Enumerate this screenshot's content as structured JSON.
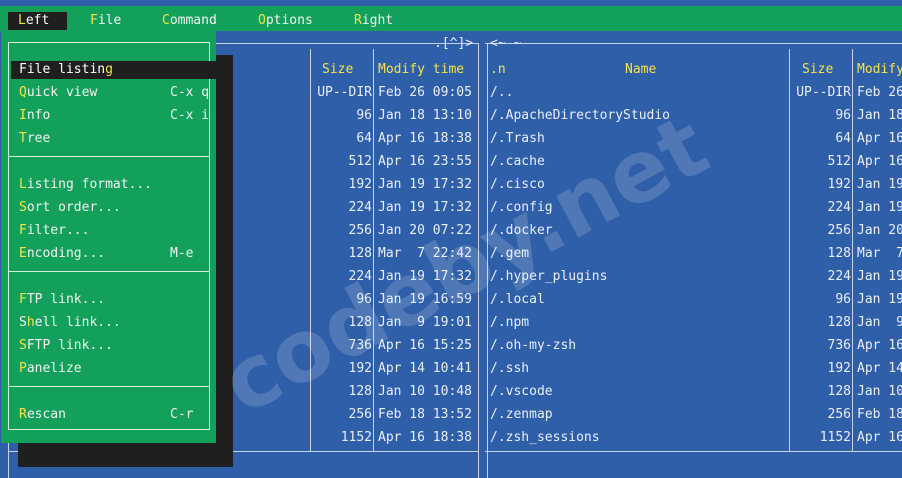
{
  "menubar": {
    "items": [
      {
        "label": "Left",
        "hot": "L",
        "rest": "eft"
      },
      {
        "label": "File",
        "hot": "F",
        "rest": "ile"
      },
      {
        "label": "Command",
        "hot": "C",
        "rest": "ommand"
      },
      {
        "label": "Options",
        "hot": "O",
        "rest": "ptions"
      },
      {
        "label": "Right",
        "hot": "R",
        "rest": "ight"
      }
    ]
  },
  "left_panel": {
    "path_hint": ".[^]>",
    "columns": {
      "size": "Size",
      "modify": "Modify time"
    },
    "rows": [
      {
        "size": "UP--DIR",
        "modify": "Feb 26 09:05"
      },
      {
        "size": "96",
        "modify": "Jan 18 13:10"
      },
      {
        "size": "64",
        "modify": "Apr 16 18:38"
      },
      {
        "size": "512",
        "modify": "Apr 16 23:55"
      },
      {
        "size": "192",
        "modify": "Jan 19 17:32"
      },
      {
        "size": "224",
        "modify": "Jan 19 17:32"
      },
      {
        "size": "256",
        "modify": "Jan 20 07:22"
      },
      {
        "size": "128",
        "modify": "Mar  7 22:42"
      },
      {
        "size": "224",
        "modify": "Jan 19 17:32"
      },
      {
        "size": "96",
        "modify": "Jan 19 16:59"
      },
      {
        "size": "128",
        "modify": "Jan  9 19:01"
      },
      {
        "size": "736",
        "modify": "Apr 16 15:25"
      },
      {
        "size": "192",
        "modify": "Apr 14 10:41"
      },
      {
        "size": "128",
        "modify": "Jan 10 10:48"
      },
      {
        "size": "256",
        "modify": "Feb 18 13:52"
      },
      {
        "size": "1152",
        "modify": "Apr 16 18:38"
      }
    ]
  },
  "right_panel": {
    "path_hint": "<~ ~",
    "columns": {
      "n": ".n",
      "name": "Name",
      "size": "Size",
      "modify": "Modify"
    },
    "rows": [
      {
        "name": "/..",
        "size": "UP--DIR",
        "modify": "Feb 26"
      },
      {
        "name": "/.ApacheDirectoryStudio",
        "size": "96",
        "modify": "Jan 18"
      },
      {
        "name": "/.Trash",
        "size": "64",
        "modify": "Apr 16"
      },
      {
        "name": "/.cache",
        "size": "512",
        "modify": "Apr 16"
      },
      {
        "name": "/.cisco",
        "size": "192",
        "modify": "Jan 19"
      },
      {
        "name": "/.config",
        "size": "224",
        "modify": "Jan 19"
      },
      {
        "name": "/.docker",
        "size": "256",
        "modify": "Jan 20"
      },
      {
        "name": "/.gem",
        "size": "128",
        "modify": "Mar  7"
      },
      {
        "name": "/.hyper_plugins",
        "size": "224",
        "modify": "Jan 19"
      },
      {
        "name": "/.local",
        "size": "96",
        "modify": "Jan 19"
      },
      {
        "name": "/.npm",
        "size": "128",
        "modify": "Jan  9"
      },
      {
        "name": "/.oh-my-zsh",
        "size": "736",
        "modify": "Apr 16"
      },
      {
        "name": "/.ssh",
        "size": "192",
        "modify": "Apr 14"
      },
      {
        "name": "/.vscode",
        "size": "128",
        "modify": "Jan 10"
      },
      {
        "name": "/.zenmap",
        "size": "256",
        "modify": "Feb 18"
      },
      {
        "name": "/.zsh_sessions",
        "size": "1152",
        "modify": "Apr 16"
      }
    ]
  },
  "dropdown": {
    "groups": [
      [
        {
          "label": "File listing",
          "hot": "g",
          "key": ""
        },
        {
          "label": "Quick view",
          "hot": "Q",
          "key": "C-x q"
        },
        {
          "label": "Info",
          "hot": "I",
          "key": "C-x i"
        },
        {
          "label": "Tree",
          "hot": "T",
          "key": ""
        }
      ],
      [
        {
          "label": "Listing format...",
          "hot": "L",
          "key": ""
        },
        {
          "label": "Sort order...",
          "hot": "S",
          "key": ""
        },
        {
          "label": "Filter...",
          "hot": "F",
          "key": ""
        },
        {
          "label": "Encoding...",
          "hot": "E",
          "key": "M-e"
        }
      ],
      [
        {
          "label": "FTP link...",
          "hot": "F",
          "key": ""
        },
        {
          "label": "Shell link...",
          "hot": "h",
          "key": ""
        },
        {
          "label": "SFTP link...",
          "hot": "S",
          "key": ""
        },
        {
          "label": "Panelize",
          "hot": "P",
          "key": ""
        }
      ],
      [
        {
          "label": "Rescan",
          "hot": "R",
          "key": "C-r"
        }
      ]
    ]
  },
  "watermark": "codeby.net",
  "colors": {
    "panel_bg": "#2f5fa8",
    "menu_bg": "#12a05a",
    "hotkey": "#f6e34a",
    "selected_bg": "#1f1f1f"
  }
}
